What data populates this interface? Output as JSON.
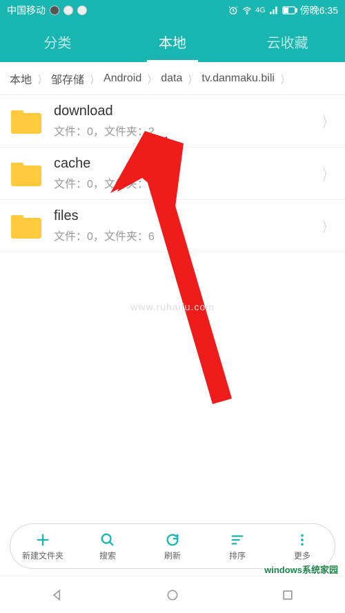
{
  "status": {
    "carrier": "中国移动",
    "time": "傍晚6:35",
    "signal": "4G"
  },
  "tabs": {
    "items": [
      {
        "label": "分类",
        "active": false
      },
      {
        "label": "本地",
        "active": true
      },
      {
        "label": "云收藏",
        "active": false
      }
    ]
  },
  "breadcrumb": {
    "items": [
      "本地",
      "邹存储",
      "Android",
      "data",
      "tv.danmaku.bili"
    ]
  },
  "folders": [
    {
      "name": "download",
      "sub": "文件：0，文件夹：2"
    },
    {
      "name": "cache",
      "sub": "文件：0，文件夹：4"
    },
    {
      "name": "files",
      "sub": "文件：0，文件夹：6"
    }
  ],
  "toolbar": {
    "new": "新建文件夹",
    "search": "搜索",
    "refresh": "刷新",
    "sort": "排序",
    "more": "更多"
  },
  "watermark": {
    "main": "windows系统家园",
    "sub": "www.ruhaifu.com"
  }
}
